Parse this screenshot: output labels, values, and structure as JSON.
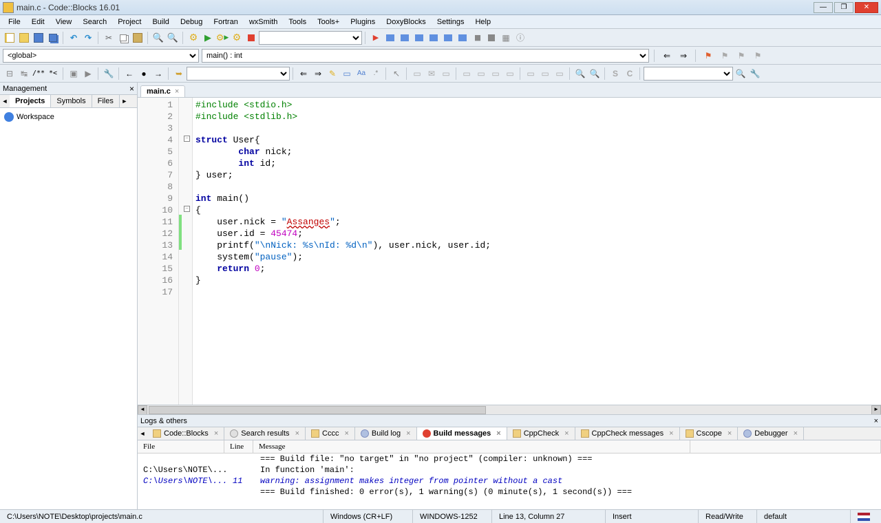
{
  "title": "main.c - Code::Blocks 16.01",
  "menus": [
    "File",
    "Edit",
    "View",
    "Search",
    "Project",
    "Build",
    "Debug",
    "Fortran",
    "wxSmith",
    "Tools",
    "Tools+",
    "Plugins",
    "DoxyBlocks",
    "Settings",
    "Help"
  ],
  "scope": {
    "global": "<global>",
    "function": "main() : int"
  },
  "mgmt": {
    "title": "Management",
    "tabs": [
      "Projects",
      "Symbols",
      "Files"
    ],
    "active_tab": "Projects",
    "workspace": "Workspace"
  },
  "editor": {
    "tab": "main.c",
    "lines": [
      "1",
      "2",
      "3",
      "4",
      "5",
      "6",
      "7",
      "8",
      "9",
      "10",
      "11",
      "12",
      "13",
      "14",
      "15",
      "16",
      "17"
    ],
    "code": {
      "l1": {
        "pre": "#include ",
        "inc": "<stdio.h>"
      },
      "l2": {
        "pre": "#include ",
        "inc": "<stdlib.h>"
      },
      "l4": {
        "kw": "struct",
        "rest": " User{"
      },
      "l5": {
        "indent": "        ",
        "kw": "char",
        "rest": " nick;"
      },
      "l6": {
        "indent": "        ",
        "kw": "int",
        "rest": " id;"
      },
      "l7": "} user;",
      "l9": {
        "kw": "int",
        "rest": " main()"
      },
      "l10": "{",
      "l11": {
        "indent": "    user.nick = ",
        "q1": "\"",
        "err": "Assanges",
        "q2": "\"",
        "rest": ";"
      },
      "l12": {
        "indent": "    user.id = ",
        "num": "45474",
        "rest": ";"
      },
      "l13": {
        "indent": "    printf(",
        "str": "\"\\nNick: %s\\nId: %d\\n\"",
        "rest": "), user.nick, user.id;"
      },
      "l14": {
        "indent": "    system(",
        "str": "\"pause\"",
        "rest": ");"
      },
      "l15": {
        "indent": "    ",
        "kw": "return",
        "sp": " ",
        "num": "0",
        "rest": ";"
      },
      "l16": "}"
    }
  },
  "logs": {
    "title": "Logs & others",
    "tabs": [
      "Code::Blocks",
      "Search results",
      "Cccc",
      "Build log",
      "Build messages",
      "CppCheck",
      "CppCheck messages",
      "Cscope",
      "Debugger"
    ],
    "active_tab": "Build messages",
    "columns": [
      "File",
      "Line",
      "Message"
    ],
    "rows": [
      {
        "file": "",
        "line": "",
        "msg": "=== Build file: \"no target\" in \"no project\" (compiler: unknown) ==="
      },
      {
        "file": "C:\\Users\\NOTE\\...",
        "line": "",
        "msg": "In function 'main':"
      },
      {
        "file": "C:\\Users\\NOTE\\...",
        "line": "11",
        "msg": "warning: assignment makes integer from pointer without a cast",
        "warn": true
      },
      {
        "file": "",
        "line": "",
        "msg": "=== Build finished: 0 error(s), 1 warning(s) (0 minute(s), 1 second(s)) ==="
      }
    ]
  },
  "status": {
    "path": "C:\\Users\\NOTE\\Desktop\\projects\\main.c",
    "eol": "Windows (CR+LF)",
    "encoding": "WINDOWS-1252",
    "position": "Line 13, Column 27",
    "insert": "Insert",
    "rw": "Read/Write",
    "profile": "default"
  }
}
